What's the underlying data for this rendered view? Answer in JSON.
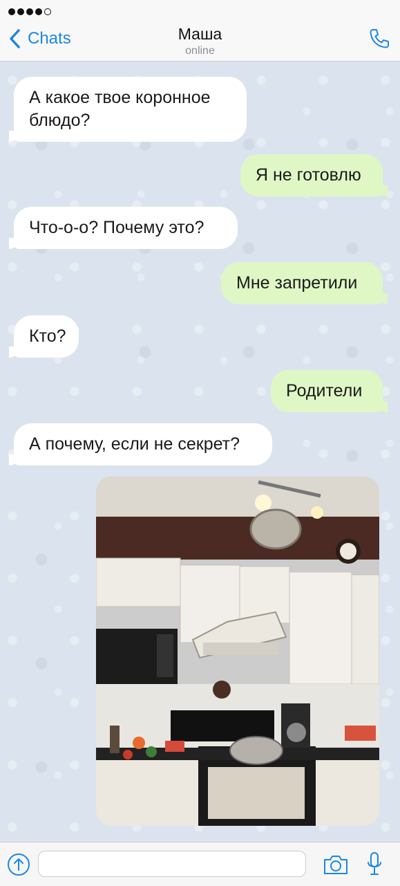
{
  "status_bar": {
    "signal_bars_filled": 4,
    "signal_bars_total": 5
  },
  "nav": {
    "back_label": "Chats",
    "back_icon": "chevron-left-icon",
    "contact_name": "Маша",
    "contact_status": "online",
    "call_icon": "phone-icon"
  },
  "messages": [
    {
      "direction": "incoming",
      "text": "А какое твое коронное блюдо?"
    },
    {
      "direction": "outgoing",
      "text": "Я не готовлю"
    },
    {
      "direction": "incoming",
      "text": "Что-о-о? Почему это?"
    },
    {
      "direction": "outgoing",
      "text": "Мне запретили"
    },
    {
      "direction": "incoming",
      "text": "Кто?"
    },
    {
      "direction": "outgoing",
      "text": "Родители"
    },
    {
      "direction": "incoming",
      "text": "А почему, если не секрет?"
    },
    {
      "direction": "outgoing",
      "type": "photo"
    }
  ],
  "input_bar": {
    "attach_icon": "upload-arrow-icon",
    "message_value": "",
    "camera_icon": "camera-icon",
    "mic_icon": "microphone-icon"
  },
  "colors": {
    "accent": "#1a87e6",
    "incoming_bubble": "#ffffff",
    "outgoing_bubble": "#dff7c5",
    "chat_background": "#dbe4ee"
  }
}
